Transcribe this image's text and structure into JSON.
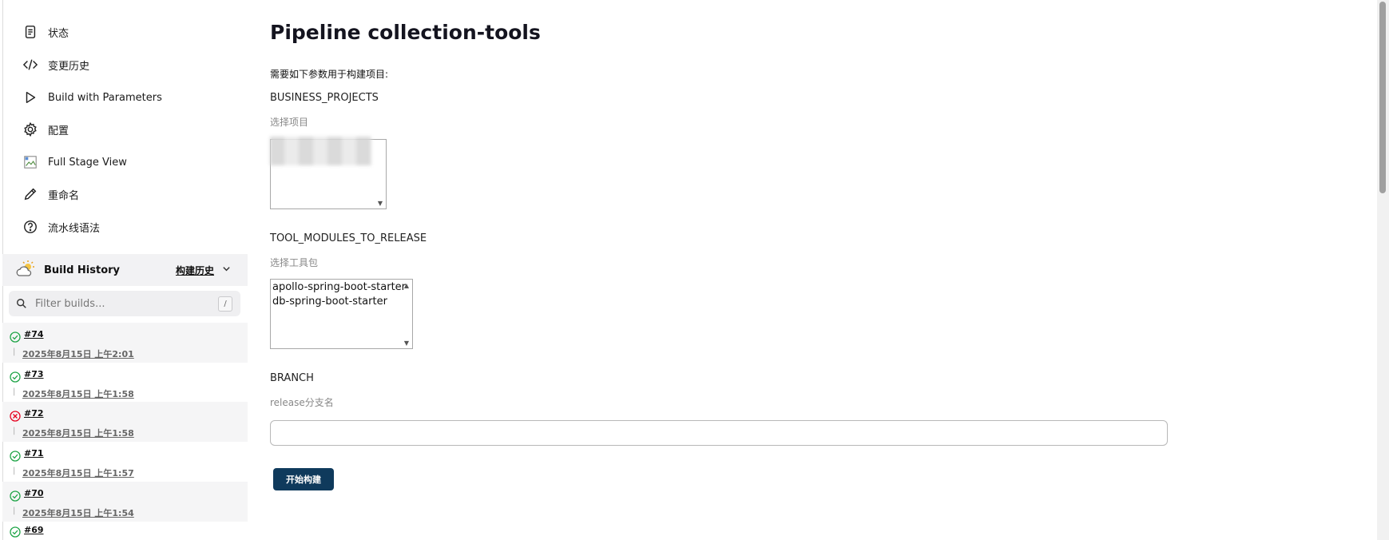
{
  "sidebar": {
    "items": [
      {
        "label": "状态",
        "icon": "document-icon"
      },
      {
        "label": "变更历史",
        "icon": "code-icon"
      },
      {
        "label": "Build with Parameters",
        "icon": "play-icon"
      },
      {
        "label": "配置",
        "icon": "gear-icon"
      },
      {
        "label": "Full Stage View",
        "icon": "broken-image-icon"
      },
      {
        "label": "重命名",
        "icon": "pencil-icon"
      },
      {
        "label": "流水线语法",
        "icon": "help-icon"
      }
    ]
  },
  "build_history": {
    "title": "Build History",
    "trend_link": "构建历史",
    "filter_placeholder": "Filter builds...",
    "filter_shortcut": "/",
    "builds": [
      {
        "number": "#74",
        "date": "2025年8月15日 上午2:01",
        "status": "success"
      },
      {
        "number": "#73",
        "date": "2025年8月15日 上午1:58",
        "status": "success"
      },
      {
        "number": "#72",
        "date": "2025年8月15日 上午1:58",
        "status": "failed"
      },
      {
        "number": "#71",
        "date": "2025年8月15日 上午1:57",
        "status": "success"
      },
      {
        "number": "#70",
        "date": "2025年8月15日 上午1:54",
        "status": "success"
      },
      {
        "number": "#69",
        "date": "",
        "status": "success"
      }
    ]
  },
  "main": {
    "title": "Pipeline collection-tools",
    "intro": "需要如下参数用于构建项目:",
    "params": {
      "business": {
        "name": "BUSINESS_PROJECTS",
        "description": "选择项目"
      },
      "tools": {
        "name": "TOOL_MODULES_TO_RELEASE",
        "description": "选择工具包",
        "options": [
          "apollo-spring-boot-starter",
          "db-spring-boot-starter"
        ]
      },
      "branch": {
        "name": "BRANCH",
        "description": "release分支名",
        "value": ""
      }
    },
    "build_button": "开始构建"
  },
  "colors": {
    "success": "#1ea446",
    "failed": "#e6001e",
    "button": "#0f3a5c"
  }
}
